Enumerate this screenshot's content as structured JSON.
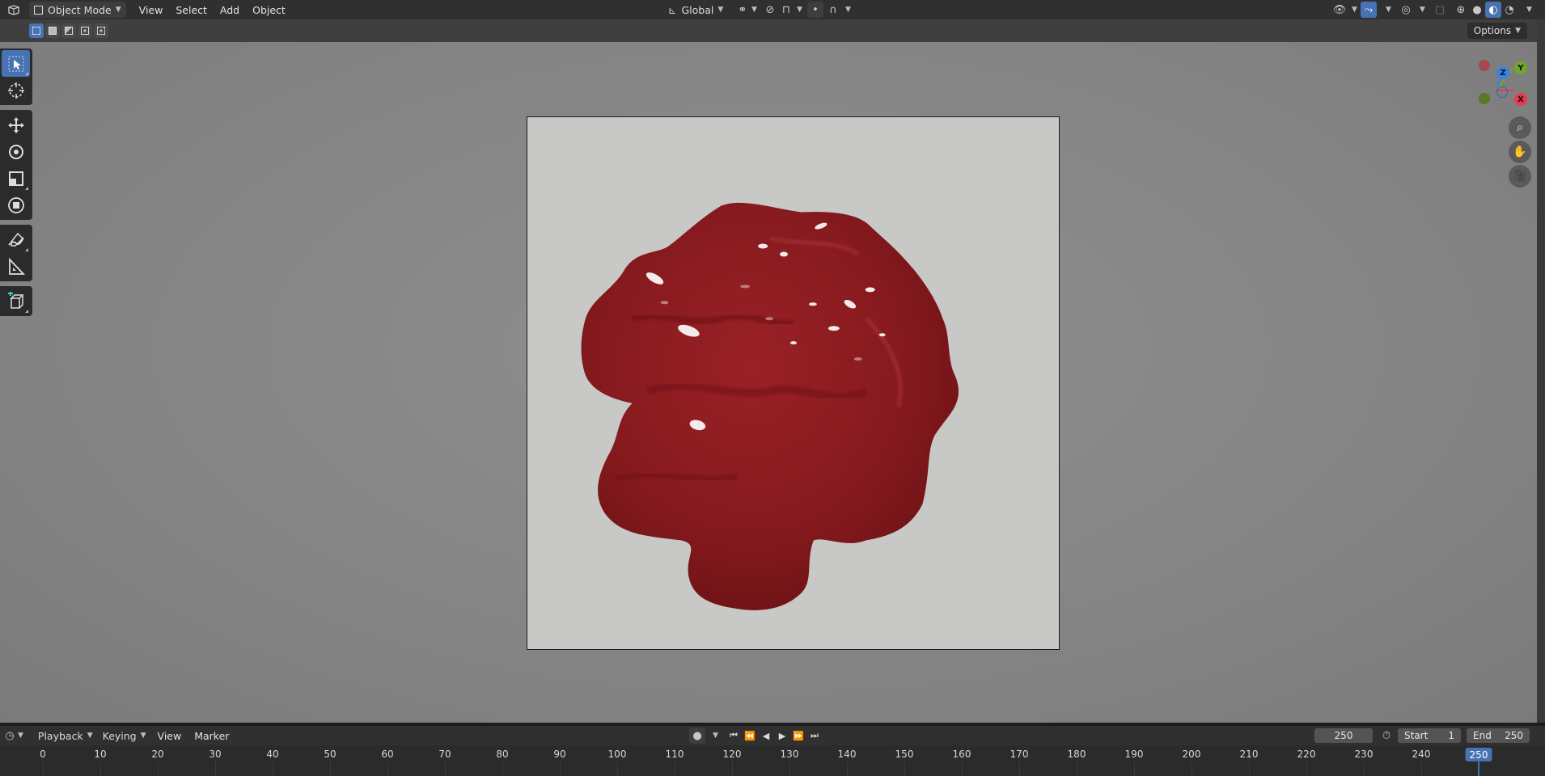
{
  "header": {
    "editor_type_icon": "viewport-editor-icon",
    "mode": "Object Mode",
    "menus": [
      "View",
      "Select",
      "Add",
      "Object"
    ],
    "transform_orientation": "Global"
  },
  "subbar": {
    "options_label": "Options"
  },
  "gizmo": {
    "axes": {
      "z": "Z",
      "y": "Y",
      "x": "X"
    },
    "colors": {
      "x": "#e8394f",
      "y": "#6ea828",
      "z": "#3b82e8"
    }
  },
  "timeline": {
    "menus": [
      "Playback",
      "Keying",
      "View",
      "Marker"
    ],
    "current_frame": "250",
    "start_label": "Start",
    "start_value": "1",
    "end_label": "End",
    "end_value": "250",
    "ruler_labels": [
      "0",
      "10",
      "20",
      "30",
      "40",
      "50",
      "60",
      "70",
      "80",
      "90",
      "100",
      "110",
      "120",
      "130",
      "140",
      "150",
      "160",
      "170",
      "180",
      "190",
      "200",
      "210",
      "220",
      "230",
      "240"
    ],
    "marker_label": "250",
    "accent": "#4772b3"
  },
  "render": {
    "object_color": "#8b1a1d",
    "background": "#c8c8c6"
  }
}
